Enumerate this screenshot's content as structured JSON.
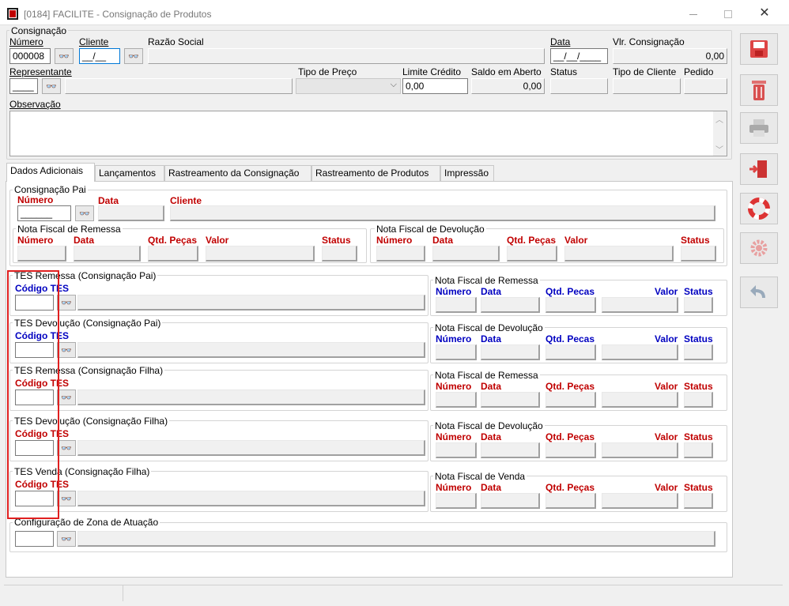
{
  "window": {
    "title": "[0184] FACILITE - Consignação de Produtos"
  },
  "top": {
    "group_title": "Consignação",
    "numero_label": "Número",
    "numero_value": "000008",
    "cliente_label": "Cliente",
    "cliente_value": "__/__",
    "razao_label": "Razão Social",
    "data_label": "Data",
    "data_value": "__/__/____",
    "vlr_label": "Vlr. Consignação",
    "vlr_value": "0,00",
    "representante_label": "Representante",
    "representante_value": "____",
    "tipo_preco_label": "Tipo de Preço",
    "limite_label": "Limite Crédito",
    "limite_value": "0,00",
    "saldo_label": "Saldo em Aberto",
    "saldo_value": "0,00",
    "status_label": "Status",
    "tipo_cliente_label": "Tipo de Cliente",
    "pedido_label": "Pedido",
    "obs_label": "Observação"
  },
  "tabs": [
    "Dados Adicionais",
    "Lançamentos",
    "Rastreamento da Consignação",
    "Rastreamento de Produtos",
    "Impressão"
  ],
  "pai": {
    "title": "Consignação Pai",
    "numero": "Número",
    "numero_value": "______",
    "data": "Data",
    "cliente": "Cliente",
    "nfr_title": "Nota Fiscal de Remessa",
    "nfd_title": "Nota Fiscal de Devolução",
    "cols": {
      "numero": "Número",
      "data": "Data",
      "qtd": "Qtd. Peças",
      "valor": "Valor",
      "status": "Status"
    }
  },
  "tes": [
    {
      "title": "TES Remessa (Consignação Pai)",
      "code": "Código TES",
      "nf": "Nota Fiscal de Remessa",
      "qtd": "Qtd. Pecas",
      "color": "blue"
    },
    {
      "title": "TES Devolução (Consignação Pai)",
      "code": "Código TES",
      "nf": "Nota Fiscal de Devolução",
      "qtd": "Qtd. Pecas",
      "color": "blue"
    },
    {
      "title": "TES Remessa (Consignação Filha)",
      "code": "Código TES",
      "nf": "Nota Fiscal de Remessa",
      "qtd": "Qtd. Peças",
      "color": "red"
    },
    {
      "title": "TES Devolução (Consignação Filha)",
      "code": "Código TES",
      "nf": "Nota Fiscal de Devolução",
      "qtd": "Qtd. Peças",
      "color": "red"
    },
    {
      "title": "TES Venda (Consignação Filha)",
      "code": "Código TES",
      "nf": "Nota Fiscal de Venda",
      "qtd": "Qtd. Peças",
      "color": "red"
    }
  ],
  "tes_cols": {
    "numero": "Número",
    "data": "Data",
    "valor": "Valor",
    "status": "Status"
  },
  "zona": {
    "title": "Configuração de Zona de Atuação"
  },
  "icons": {
    "save": "save-icon",
    "delete": "trash-icon",
    "print": "printer-icon",
    "exit": "exit-door-icon",
    "help": "lifebuoy-icon",
    "config": "gear-icon",
    "undo": "undo-icon"
  }
}
